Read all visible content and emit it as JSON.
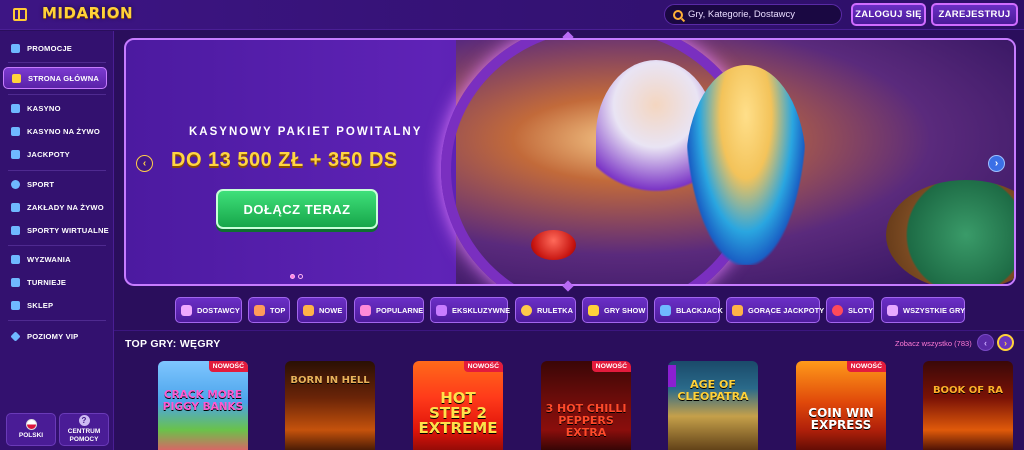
{
  "header": {
    "logo": "MIDARION",
    "search_placeholder": "Gry, Kategorie, Dostawcy",
    "login_label": "ZALOGUJ SIĘ",
    "register_label": "ZAREJESTRUJ"
  },
  "sidebar": {
    "items": [
      {
        "label": "PROMOCJE",
        "icon": "gift-icon",
        "color": "#6fb8ff"
      },
      {
        "label": "STRONA GŁÓWNA",
        "icon": "home-icon",
        "color": "#ffd23a"
      },
      {
        "label": "KASYNO",
        "icon": "slot-icon",
        "color": "#6fb8ff"
      },
      {
        "label": "KASYNO NA ŻYWO",
        "icon": "live-icon",
        "color": "#6fb8ff"
      },
      {
        "label": "JACKPOTY",
        "icon": "jackpot-icon",
        "color": "#6fb8ff"
      },
      {
        "label": "SPORT",
        "icon": "ball-icon",
        "color": "#6fb8ff"
      },
      {
        "label": "ZAKŁADY NA ŻYWO",
        "icon": "live-bet-icon",
        "color": "#6fb8ff"
      },
      {
        "label": "SPORTY WIRTUALNE",
        "icon": "gamepad-icon",
        "color": "#6fb8ff"
      },
      {
        "label": "WYZWANIA",
        "icon": "challenge-icon",
        "color": "#6fb8ff"
      },
      {
        "label": "TURNIEJE",
        "icon": "trophy-icon",
        "color": "#6fb8ff"
      },
      {
        "label": "SKLEP",
        "icon": "shop-icon",
        "color": "#6fb8ff"
      },
      {
        "label": "POZIOMY VIP",
        "icon": "diamond-icon",
        "color": "#6fb8ff"
      }
    ],
    "language_label": "POLSKI",
    "help_label_1": "CENTRUM",
    "help_label_2": "POMOCY"
  },
  "hero": {
    "subtitle": "KASYNOWY PAKIET POWITALNY",
    "title": "DO 13 500 ZŁ + 350 DS",
    "cta": "DOŁĄCZ TERAZ",
    "slide_count": 2,
    "active_slide": 1
  },
  "categories": [
    {
      "label": "DOSTAWCY",
      "color": "#f0a8ff"
    },
    {
      "label": "TOP",
      "color": "#ff9b5a"
    },
    {
      "label": "NOWE",
      "color": "#ffb347"
    },
    {
      "label": "POPULARNE",
      "color": "#ff8ad8"
    },
    {
      "label": "EKSKLUZYWNE",
      "color": "#c87cff"
    },
    {
      "label": "RULETKA",
      "color": "#ffc94a"
    },
    {
      "label": "GRY SHOW",
      "color": "#ffd23a"
    },
    {
      "label": "BLACKJACK",
      "color": "#6fb8ff"
    },
    {
      "label": "GORĄCE JACKPOTY",
      "color": "#ffb347"
    },
    {
      "label": "SLOTY",
      "color": "#ff4a5a"
    },
    {
      "label": "WSZYSTKIE GRY",
      "color": "#e7a8ff"
    }
  ],
  "top_games": {
    "title": "TOP GRY: WĘGRY",
    "see_all": "Zobacz wszystko (783)",
    "new_badge": "NOWOŚĆ",
    "games": [
      {
        "title": "CRACK MORE PIGGY BANKS",
        "new": true
      },
      {
        "title": "BORN IN HELL",
        "new": false
      },
      {
        "title": "HOT STEP 2 EXTREME",
        "new": true
      },
      {
        "title": "3 HOT CHILLI PEPPERS EXTRA",
        "new": true
      },
      {
        "title": "AGE OF CLEOPATRA",
        "new": false
      },
      {
        "title": "COIN WIN EXPRESS",
        "new": true
      },
      {
        "title": "BOOK OF RA",
        "new": false
      }
    ]
  }
}
